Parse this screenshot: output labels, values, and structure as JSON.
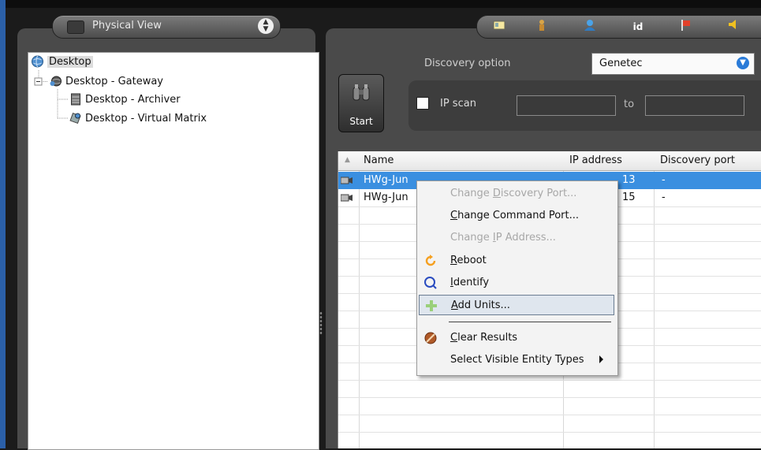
{
  "left_panel": {
    "view_selector_label": "Physical View",
    "tree": [
      {
        "label": "Desktop",
        "icon": "globe-icon"
      },
      {
        "label": "Desktop - Gateway",
        "icon": "gateway-globe-icon"
      },
      {
        "label": "Desktop - Archiver",
        "icon": "archiver-server-icon"
      },
      {
        "label": "Desktop - Virtual Matrix",
        "icon": "virtual-matrix-icon"
      }
    ]
  },
  "toolbar": {
    "buttons": [
      {
        "name": "id-card-icon"
      },
      {
        "name": "person-icon"
      },
      {
        "name": "user-group-icon"
      },
      {
        "name": "id-icon",
        "text": "id"
      },
      {
        "name": "flag-icon"
      },
      {
        "name": "speaker-icon"
      }
    ]
  },
  "discovery": {
    "start_label": "Start",
    "option_label": "Discovery option",
    "option_value": "Genetec",
    "ipscan_label": "IP scan",
    "to_label": "to"
  },
  "grid": {
    "headers": {
      "name": "Name",
      "ip": "IP address",
      "port": "Discovery port"
    },
    "rows": [
      {
        "name": "HWg-Jun",
        "ip": "13",
        "port": "-"
      },
      {
        "name": "HWg-Jun",
        "ip": "15",
        "port": "-"
      }
    ]
  },
  "context_menu": {
    "items": [
      {
        "label": "Change Discovery Port...",
        "underline": "D",
        "enabled": false
      },
      {
        "label": "Change Command Port...",
        "underline": "C",
        "enabled": true
      },
      {
        "label": "Change IP Address...",
        "underline": "I",
        "enabled": false
      },
      {
        "label": "Reboot",
        "underline": "R",
        "enabled": true,
        "icon": "reboot-icon"
      },
      {
        "label": "Identify",
        "underline": "I",
        "enabled": true,
        "icon": "identify-icon"
      },
      {
        "label": "Add Units...",
        "underline": "A",
        "enabled": true,
        "icon": "add-icon"
      },
      {
        "label": "Clear Results",
        "underline": "C",
        "enabled": true,
        "icon": "clear-icon"
      },
      {
        "label": "Select Visible Entity Types",
        "enabled": true
      }
    ]
  },
  "colors": {
    "selection": "#3a8fe0",
    "panel_bg": "#4a4a4a",
    "reboot": "#f5a020",
    "identify": "#2a4cc0",
    "add": "#9ad07a",
    "clear": "#b05a28"
  }
}
